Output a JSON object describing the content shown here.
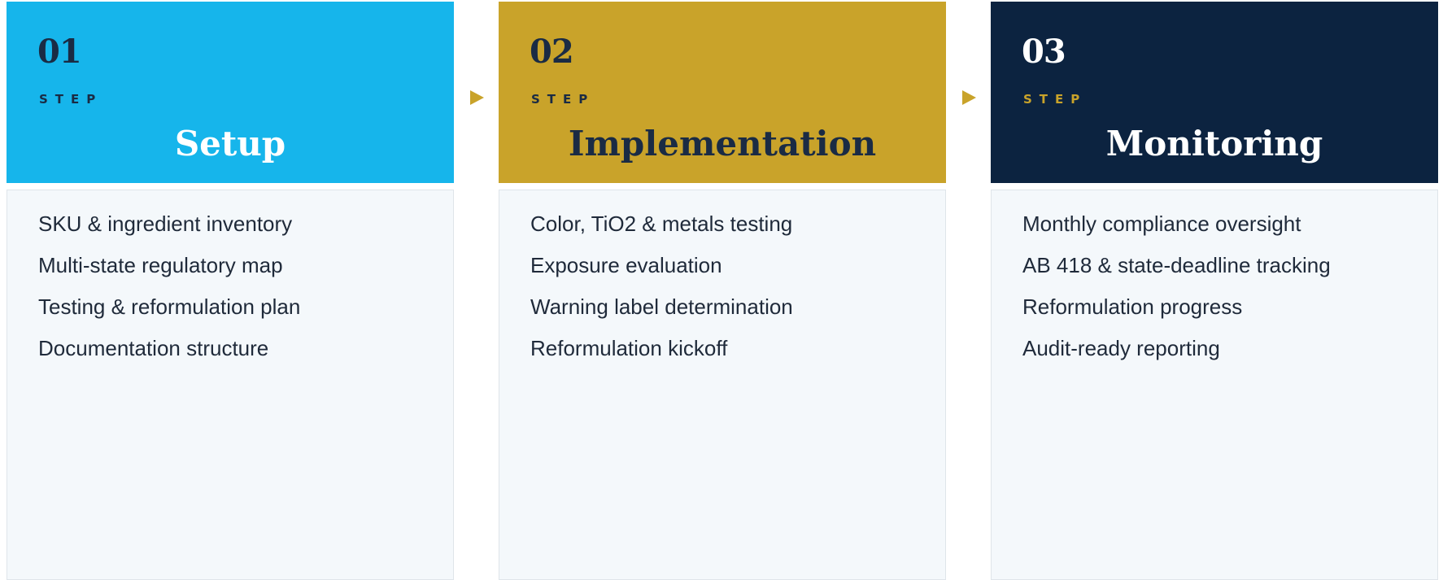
{
  "colors": {
    "step1_bg": "#16b5eb",
    "step2_bg": "#c9a32a",
    "step3_bg": "#0c2340",
    "navy": "#1a2b44",
    "gold": "#c9a32a",
    "white": "#ffffff",
    "arrow": "#c9a32a"
  },
  "steps": [
    {
      "number": "01",
      "tag": "STEP",
      "title": "Setup",
      "items": [
        "SKU & ingredient inventory",
        "Multi-state regulatory map",
        "Testing & reformulation plan",
        "Documentation structure"
      ]
    },
    {
      "number": "02",
      "tag": "STEP",
      "title": "Implementation",
      "items": [
        "Color, TiO2 & metals testing",
        "Exposure evaluation",
        "Warning label determination",
        "Reformulation kickoff"
      ]
    },
    {
      "number": "03",
      "tag": "STEP",
      "title": "Monitoring",
      "items": [
        "Monthly compliance oversight",
        "AB 418 & state-deadline tracking",
        "Reformulation progress",
        "Audit-ready reporting"
      ]
    }
  ]
}
